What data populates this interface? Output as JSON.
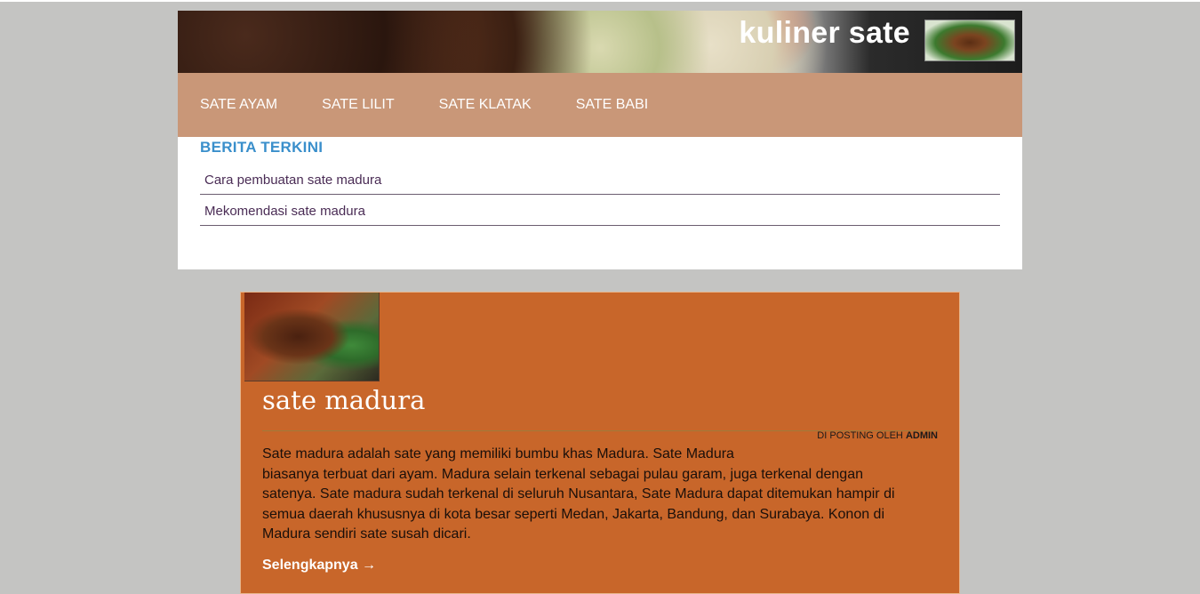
{
  "site": {
    "brand": "kuliner sate",
    "header_image": "grilled-satay-banner-image",
    "logo_image": "satay-plate-image"
  },
  "nav": {
    "items": [
      {
        "label": "SATE AYAM"
      },
      {
        "label": "SATE LILIT"
      },
      {
        "label": "SATE KLATAK"
      },
      {
        "label": "SATE BABI"
      }
    ]
  },
  "news": {
    "title": "BERITA TERKINI",
    "items": [
      {
        "label": "Cara pembuatan sate madura"
      },
      {
        "label": "Mekomendasi sate madura"
      }
    ]
  },
  "post": {
    "thumbnail": "sate-madura-image",
    "title": "sate madura",
    "meta_prefix": "DI POSTING OLEH",
    "author": "ADMIN",
    "body_lines": [
      "Sate madura adalah sate yang memiliki bumbu khas Madura. Sate Madura",
      "biasanya terbuat dari ayam. Madura selain terkenal sebagai pulau garam, juga terkenal dengan",
      "satenya. Sate madura sudah terkenal di seluruh Nusantara, Sate Madura dapat ditemukan hampir di",
      "semua daerah khususnya di kota besar seperti Medan, Jakarta, Bandung, dan Surabaya. Konon di",
      "Madura sendiri sate susah dicari."
    ],
    "read_more": "Selengkapnya →"
  },
  "colors": {
    "page_bg": "#c4c4c2",
    "nav_bg": "#c99778",
    "news_title": "#3a8fcb",
    "post_bg": "#c8662a"
  }
}
